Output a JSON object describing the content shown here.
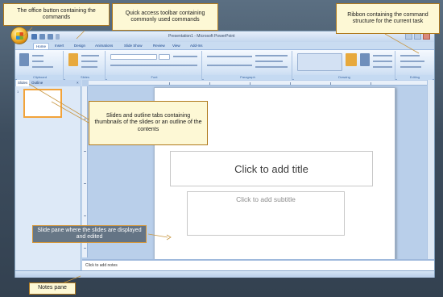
{
  "window": {
    "title": "Presentation1 - Microsoft PowerPoint"
  },
  "ribbon": {
    "tabs": [
      "Home",
      "Insert",
      "Design",
      "Animations",
      "Slide Show",
      "Review",
      "View",
      "Add-Ins"
    ],
    "groups": [
      "Clipboard",
      "Slides",
      "Font",
      "Paragraph",
      "Drawing",
      "Editing"
    ]
  },
  "left_panel": {
    "tabs": [
      "Slides",
      "Outline"
    ],
    "thumb_number": "1"
  },
  "slide": {
    "title_placeholder": "Click to add title",
    "subtitle_placeholder": "Click to add subtitle"
  },
  "notes": {
    "placeholder": "Click to add notes"
  },
  "callouts": {
    "office_button": "The office button containing the commands",
    "quick_access": "Quick access toolbar containing commonly used commands",
    "ribbon": "Ribbon containing the command structure for the current task",
    "slides_outline": "Slides and outline tabs containing thumbnails of the slides or an outline of the contents",
    "slide_pane": "Slide pane where the slides are displayed and edited",
    "notes_pane": "Notes pane"
  },
  "colors": {
    "callout_border": "#b07a1e",
    "callout_fill": "#fdf8d5",
    "thumbnail_highlight": "#f2a33a"
  }
}
